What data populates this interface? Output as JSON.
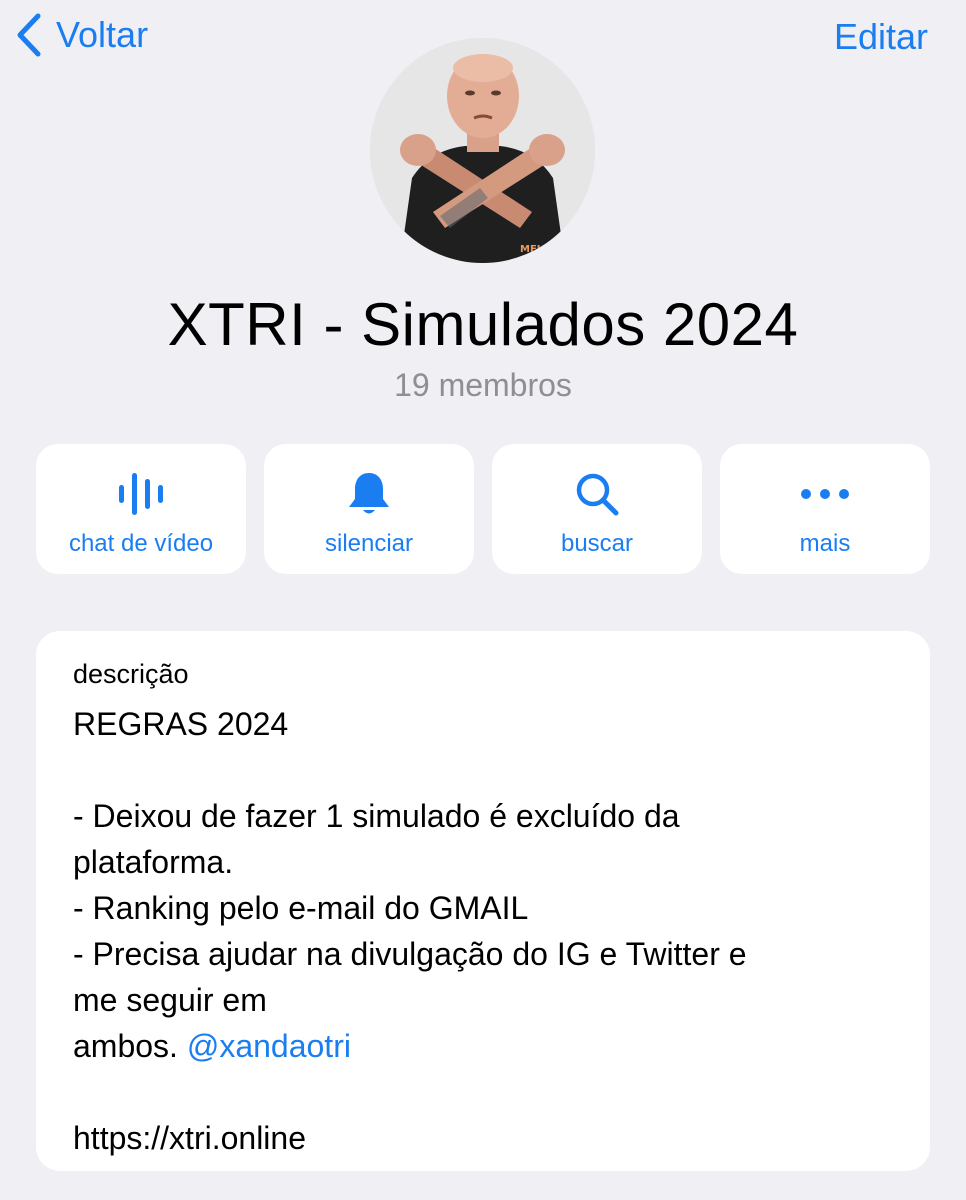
{
  "nav": {
    "back_label": "Voltar",
    "edit_label": "Editar"
  },
  "group": {
    "title": "XTRI - Simulados 2024",
    "members": "19 membros",
    "shirt_text": "MELSOT"
  },
  "actions": [
    {
      "label": "chat de vídeo",
      "icon": "waveform-icon"
    },
    {
      "label": "silenciar",
      "icon": "bell-icon"
    },
    {
      "label": "buscar",
      "icon": "search-icon"
    },
    {
      "label": "mais",
      "icon": "ellipsis-icon"
    }
  ],
  "description": {
    "heading": "descrição",
    "line1": "REGRAS 2024",
    "line2": "- Deixou de fazer 1 simulado é excluído da",
    "line3": "plataforma.",
    "line4": "- Ranking pelo e-mail do GMAIL",
    "line5": "- Precisa ajudar na divulgação do IG e Twitter e",
    "line6": "me seguir em",
    "line7_text": "ambos.",
    "line7_link": "@xandaotri",
    "line8": "https://xtri.online"
  },
  "colors": {
    "accent": "#1a7ef0",
    "background": "#efeff4",
    "card": "#ffffff",
    "secondary_text": "#8e8e93"
  }
}
